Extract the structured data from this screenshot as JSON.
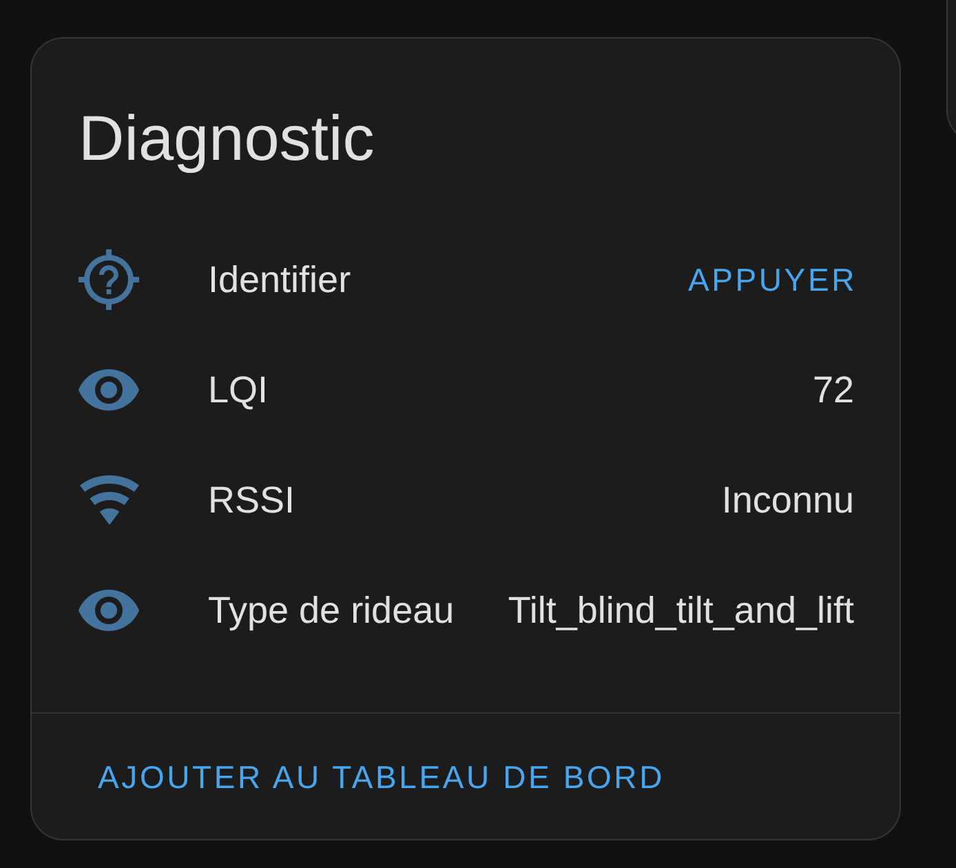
{
  "card": {
    "title": "Diagnostic",
    "rows": [
      {
        "kind": "action",
        "label": "Identifier",
        "button": "APPUYER"
      },
      {
        "kind": "sensor",
        "label": "LQI",
        "value": "72"
      },
      {
        "kind": "signal",
        "label": "RSSI",
        "value": "Inconnu"
      },
      {
        "kind": "sensor",
        "label": "Type de rideau",
        "value": "Tilt_blind_tilt_and_lift"
      }
    ],
    "footer_button": "AJOUTER AU TABLEAU DE BORD"
  }
}
